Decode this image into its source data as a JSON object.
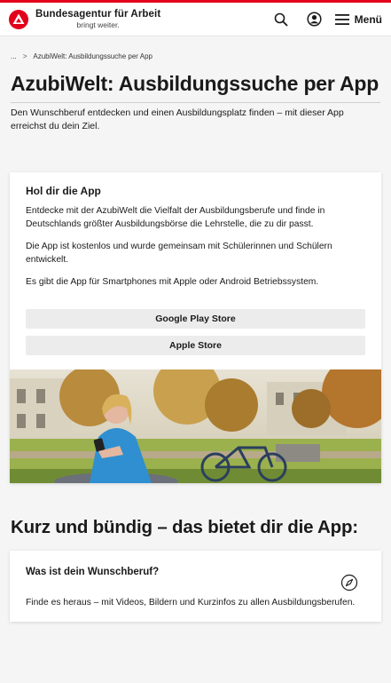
{
  "header": {
    "brand_name": "Bundesagentur für Arbeit",
    "brand_tagline": "bringt weiter.",
    "menu_label": "Menü",
    "accent_color": "#e2001a"
  },
  "breadcrumb": {
    "ellipsis": "...",
    "current": "AzubiWelt: Ausbildungssuche per App"
  },
  "page": {
    "title": "AzubiWelt: Ausbildungssuche per App",
    "intro": "Den Wunschberuf entdecken und einen Ausbildungsplatz finden – mit dieser App erreichst du dein Ziel."
  },
  "app_card": {
    "heading": "Hol dir die App",
    "paragraphs": [
      "Entdecke mit der AzubiWelt die Vielfalt der Ausbildungsberufe und finde in Deutschlands größter Ausbildungsbörse die Lehrstelle, die zu dir passt.",
      "Die App ist kostenlos und wurde gemeinsam mit Schülerinnen und Schülern entwickelt.",
      "Es gibt die App für Smartphones mit Apple oder Android Betriebssystem."
    ],
    "buttons": {
      "google": "Google Play Store",
      "apple": "Apple Store"
    }
  },
  "section": {
    "heading": "Kurz und bündig – das bietet dir die App:"
  },
  "feature_card": {
    "heading": "Was ist dein Wunschberuf?",
    "text": "Finde es heraus – mit Videos, Bildern und Kurzinfos zu allen Ausbildungsberufen.",
    "icon": "compass-icon"
  }
}
